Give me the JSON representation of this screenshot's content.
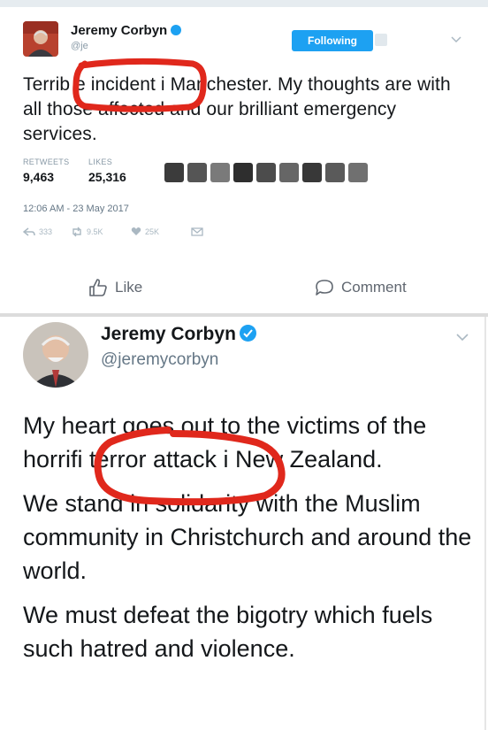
{
  "top_tweet": {
    "author_name": "Jeremy Corbyn",
    "author_handle": "@je",
    "follow_button_label": "Following",
    "text": "Terrib e incident i  Manchester. My thoughts are with all those affected and our brilliant emergency services.",
    "retweets_label": "RETWEETS",
    "retweets_count": "9,463",
    "likes_label": "LIKES",
    "likes_count": "25,316",
    "timestamp": "12:06 AM - 23 May 2017",
    "reply_count": "333",
    "retweet_action_count": "9.5K",
    "like_action_count": "25K"
  },
  "facebook_bar": {
    "like_label": "Like",
    "comment_label": "Comment"
  },
  "bottom_tweet": {
    "author_name": "Jeremy Corbyn",
    "author_handle": "@jeremycorbyn",
    "paragraphs": [
      "My heart goes out to the victims of the horrifi  terror attack i  New Zealand.",
      "We stand in solidarity with the Muslim community in Christchurch and around the world.",
      "We must defeat the bigotry which fuels such hatred and violence."
    ]
  },
  "colors": {
    "accent_blue": "#1da1f2",
    "annotation_red": "#e0281c",
    "muted_text": "#657786"
  },
  "icons": [
    "verified-badge-icon",
    "chevron-down-icon",
    "reply-icon",
    "retweet-icon",
    "heart-icon",
    "dm-icon",
    "thumbs-up-icon",
    "comment-bubble-icon"
  ]
}
